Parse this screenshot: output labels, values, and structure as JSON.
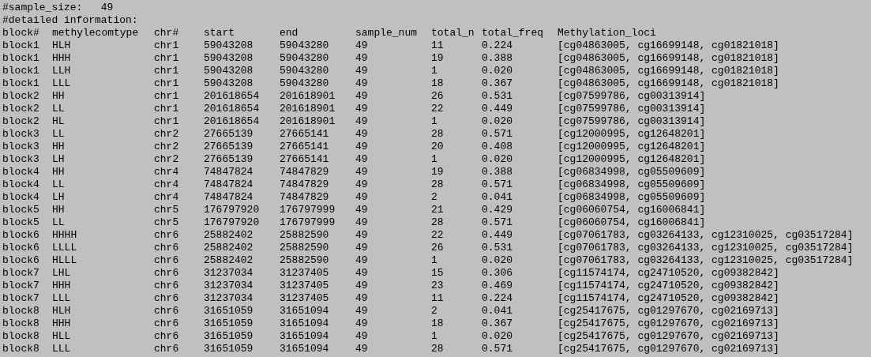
{
  "header_lines": [
    "#sample_size:   49",
    "#detailed information:"
  ],
  "table": {
    "columns": [
      "block#",
      "methylecomtype",
      "chr#",
      "start",
      "end",
      "sample_num",
      "total_n",
      "total_freq",
      "Methylation_loci"
    ],
    "rows": [
      [
        "block1",
        "HLH",
        "chr1",
        "59043208",
        "59043280",
        "49",
        "11",
        "0.224",
        "[cg04863005, cg16699148, cg01821018]"
      ],
      [
        "block1",
        "HHH",
        "chr1",
        "59043208",
        "59043280",
        "49",
        "19",
        "0.388",
        "[cg04863005, cg16699148, cg01821018]"
      ],
      [
        "block1",
        "LLH",
        "chr1",
        "59043208",
        "59043280",
        "49",
        "1",
        "0.020",
        "[cg04863005, cg16699148, cg01821018]"
      ],
      [
        "block1",
        "LLL",
        "chr1",
        "59043208",
        "59043280",
        "49",
        "18",
        "0.367",
        "[cg04863005, cg16699148, cg01821018]"
      ],
      [
        "block2",
        "HH",
        "chr1",
        "201618654",
        "201618901",
        "49",
        "26",
        "0.531",
        "[cg07599786, cg00313914]"
      ],
      [
        "block2",
        "LL",
        "chr1",
        "201618654",
        "201618901",
        "49",
        "22",
        "0.449",
        "[cg07599786, cg00313914]"
      ],
      [
        "block2",
        "HL",
        "chr1",
        "201618654",
        "201618901",
        "49",
        "1",
        "0.020",
        "[cg07599786, cg00313914]"
      ],
      [
        "block3",
        "LL",
        "chr2",
        "27665139",
        "27665141",
        "49",
        "28",
        "0.571",
        "[cg12000995, cg12648201]"
      ],
      [
        "block3",
        "HH",
        "chr2",
        "27665139",
        "27665141",
        "49",
        "20",
        "0.408",
        "[cg12000995, cg12648201]"
      ],
      [
        "block3",
        "LH",
        "chr2",
        "27665139",
        "27665141",
        "49",
        "1",
        "0.020",
        "[cg12000995, cg12648201]"
      ],
      [
        "block4",
        "HH",
        "chr4",
        "74847824",
        "74847829",
        "49",
        "19",
        "0.388",
        "[cg06834998, cg05509609]"
      ],
      [
        "block4",
        "LL",
        "chr4",
        "74847824",
        "74847829",
        "49",
        "28",
        "0.571",
        "[cg06834998, cg05509609]"
      ],
      [
        "block4",
        "LH",
        "chr4",
        "74847824",
        "74847829",
        "49",
        "2",
        "0.041",
        "[cg06834998, cg05509609]"
      ],
      [
        "block5",
        "HH",
        "chr5",
        "176797920",
        "176797999",
        "49",
        "21",
        "0.429",
        "[cg06060754, cg16006841]"
      ],
      [
        "block5",
        "LL",
        "chr5",
        "176797920",
        "176797999",
        "49",
        "28",
        "0.571",
        "[cg06060754, cg16006841]"
      ],
      [
        "block6",
        "HHHH",
        "chr6",
        "25882402",
        "25882590",
        "49",
        "22",
        "0.449",
        "[cg07061783, cg03264133, cg12310025, cg03517284]"
      ],
      [
        "block6",
        "LLLL",
        "chr6",
        "25882402",
        "25882590",
        "49",
        "26",
        "0.531",
        "[cg07061783, cg03264133, cg12310025, cg03517284]"
      ],
      [
        "block6",
        "HLLL",
        "chr6",
        "25882402",
        "25882590",
        "49",
        "1",
        "0.020",
        "[cg07061783, cg03264133, cg12310025, cg03517284]"
      ],
      [
        "block7",
        "LHL",
        "chr6",
        "31237034",
        "31237405",
        "49",
        "15",
        "0.306",
        "[cg11574174, cg24710520, cg09382842]"
      ],
      [
        "block7",
        "HHH",
        "chr6",
        "31237034",
        "31237405",
        "49",
        "23",
        "0.469",
        "[cg11574174, cg24710520, cg09382842]"
      ],
      [
        "block7",
        "LLL",
        "chr6",
        "31237034",
        "31237405",
        "49",
        "11",
        "0.224",
        "[cg11574174, cg24710520, cg09382842]"
      ],
      [
        "block8",
        "HLH",
        "chr6",
        "31651059",
        "31651094",
        "49",
        "2",
        "0.041",
        "[cg25417675, cg01297670, cg02169713]"
      ],
      [
        "block8",
        "HHH",
        "chr6",
        "31651059",
        "31651094",
        "49",
        "18",
        "0.367",
        "[cg25417675, cg01297670, cg02169713]"
      ],
      [
        "block8",
        "HLL",
        "chr6",
        "31651059",
        "31651094",
        "49",
        "1",
        "0.020",
        "[cg25417675, cg01297670, cg02169713]"
      ],
      [
        "block8",
        "LLL",
        "chr6",
        "31651059",
        "31651094",
        "49",
        "28",
        "0.571",
        "[cg25417675, cg01297670, cg02169713]"
      ]
    ]
  }
}
